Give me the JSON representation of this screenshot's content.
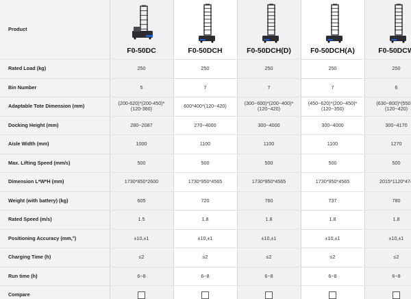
{
  "header_label": "Product",
  "models": [
    "F0-50DC",
    "F0-50DCH",
    "F0-50DCH(D)",
    "F0-50DCH(A)",
    "F0-50DCW"
  ],
  "rows": [
    {
      "label": "Rated Load (kg)",
      "values": [
        "250",
        "250",
        "250",
        "250",
        "250"
      ]
    },
    {
      "label": "Bin Number",
      "values": [
        "5",
        "7",
        "7",
        "7",
        "6"
      ]
    },
    {
      "label": "Adaptable Tote Dimension (mm)",
      "values": [
        [
          "(200-620)*(200-450)*",
          "(120-360)"
        ],
        [
          "600*400*(120~420)"
        ],
        [
          "(300~600)*(200~400)*",
          "(120~420)"
        ],
        [
          "(450~620)*(200~450)*",
          "(120~350)"
        ],
        [
          "(630~800)*(550~6",
          "(120~420)"
        ]
      ]
    },
    {
      "label": "Docking Height (mm)",
      "values": [
        "280~2087",
        "270~4000",
        "300~4000",
        "300~4000",
        "300~4170"
      ]
    },
    {
      "label": "Aisle Width (mm)",
      "values": [
        "1000",
        "1100",
        "1100",
        "1100",
        "1270"
      ]
    },
    {
      "label": "Max. Lifting Speed (mm/s)",
      "values": [
        "500",
        "500",
        "500",
        "500",
        "500"
      ]
    },
    {
      "label": "Dimension L*W*H (mm)",
      "values": [
        "1730*850*2600",
        "1730*950*4565",
        "1730*950*4565",
        "1730*950*4565",
        "2015*1120*474"
      ]
    },
    {
      "label": "Weight (with battery) (kg)",
      "values": [
        "605",
        "720",
        "760",
        "737",
        "780"
      ]
    },
    {
      "label": "Rated Speed (m/s)",
      "values": [
        "1.5",
        "1.8",
        "1.8",
        "1.8",
        "1.8"
      ]
    },
    {
      "label": "Positioning Accuracy (mm,°)",
      "values": [
        "±10,±1",
        "±10,±1",
        "±10,±1",
        "±10,±1",
        "±10,±1"
      ]
    },
    {
      "label": "Charging Time (h)",
      "values": [
        "≤2",
        "≤2",
        "≤2",
        "≤2",
        "≤2"
      ]
    },
    {
      "label": "Run time (h)",
      "values": [
        "6~8",
        "6~8",
        "6~8",
        "6~8",
        "6~8"
      ]
    }
  ],
  "compare_label": "Compare",
  "compare_checked": [
    false,
    false,
    false,
    false,
    false
  ],
  "icons": {
    "product": "robot-image",
    "compare": "checkbox-icon"
  }
}
